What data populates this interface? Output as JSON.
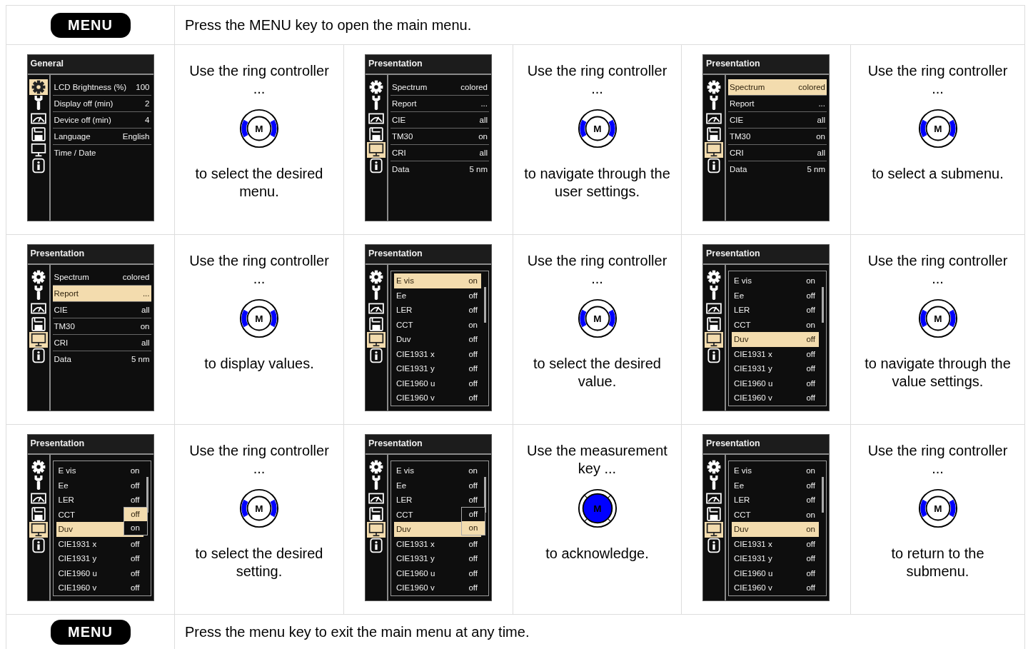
{
  "intro": {
    "key": "MENU",
    "text": "Press the MENU key to open the main menu."
  },
  "steps": [
    {
      "screen": {
        "kind": "menu",
        "title": "General",
        "sidebar": [
          {
            "kind": "gear",
            "selected": true
          },
          {
            "kind": "wrench",
            "selected": false
          },
          {
            "kind": "gauge",
            "selected": false
          },
          {
            "kind": "floppy",
            "selected": false
          },
          {
            "kind": "monitor",
            "selected": false
          },
          {
            "kind": "info",
            "selected": false
          }
        ],
        "items": [
          {
            "label": "LCD Brightness (%)",
            "value": "100",
            "selected": false
          },
          {
            "label": "Display off (min)",
            "value": "2",
            "selected": false
          },
          {
            "label": "Device off (min)",
            "value": "4",
            "selected": false
          },
          {
            "label": "Language",
            "value": "English",
            "selected": false
          },
          {
            "label": "Time / Date",
            "selected": false
          }
        ]
      },
      "before": "Use the ring controller ...",
      "knob": {
        "kind": "ring",
        "label": "M"
      },
      "after": "to select the desired menu."
    },
    {
      "screen": {
        "kind": "menu",
        "title": "Presentation",
        "sidebar": [
          {
            "kind": "gear",
            "selected": false
          },
          {
            "kind": "wrench",
            "selected": false
          },
          {
            "kind": "gauge",
            "selected": false
          },
          {
            "kind": "floppy",
            "selected": false
          },
          {
            "kind": "monitor",
            "selected": true
          },
          {
            "kind": "info",
            "selected": false
          }
        ],
        "items": [
          {
            "label": "Spectrum",
            "value": "colored",
            "selected": false
          },
          {
            "label": "Report",
            "value": "...",
            "selected": false
          },
          {
            "label": "CIE",
            "value": "all",
            "selected": false
          },
          {
            "label": "TM30",
            "value": "on",
            "selected": false
          },
          {
            "label": "CRI",
            "value": "all",
            "selected": false
          },
          {
            "label": "Data",
            "value": "5 nm",
            "selected": false
          }
        ]
      },
      "before": "Use the ring controller ...",
      "knob": {
        "kind": "ring",
        "label": "M"
      },
      "after": "to navigate through the user settings."
    },
    {
      "screen": {
        "kind": "menu",
        "title": "Presentation",
        "sidebar": [
          {
            "kind": "gear",
            "selected": false
          },
          {
            "kind": "wrench",
            "selected": false
          },
          {
            "kind": "gauge",
            "selected": false
          },
          {
            "kind": "floppy",
            "selected": false
          },
          {
            "kind": "monitor",
            "selected": true
          },
          {
            "kind": "info",
            "selected": false
          }
        ],
        "items": [
          {
            "label": "Spectrum",
            "value": "colored",
            "selected": true
          },
          {
            "label": "Report",
            "value": "...",
            "selected": false
          },
          {
            "label": "CIE",
            "value": "all",
            "selected": false
          },
          {
            "label": "TM30",
            "value": "on",
            "selected": false
          },
          {
            "label": "CRI",
            "value": "all",
            "selected": false
          },
          {
            "label": "Data",
            "value": "5 nm",
            "selected": false
          }
        ]
      },
      "before": "Use the ring controller ...",
      "knob": {
        "kind": "ring",
        "label": "M"
      },
      "after": "to select a submenu."
    },
    {
      "screen": {
        "kind": "menu",
        "title": "Presentation",
        "sidebar": [
          {
            "kind": "gear",
            "selected": false
          },
          {
            "kind": "wrench",
            "selected": false
          },
          {
            "kind": "gauge",
            "selected": false
          },
          {
            "kind": "floppy",
            "selected": false
          },
          {
            "kind": "monitor",
            "selected": true
          },
          {
            "kind": "info",
            "selected": false
          }
        ],
        "items": [
          {
            "label": "Spectrum",
            "value": "colored",
            "selected": false
          },
          {
            "label": "Report",
            "value": "...",
            "selected": true
          },
          {
            "label": "CIE",
            "value": "all",
            "selected": false
          },
          {
            "label": "TM30",
            "value": "on",
            "selected": false
          },
          {
            "label": "CRI",
            "value": "all",
            "selected": false
          },
          {
            "label": "Data",
            "value": "5 nm",
            "selected": false
          }
        ]
      },
      "before": "Use the ring controller ...",
      "knob": {
        "kind": "ring",
        "label": "M"
      },
      "after": "to display values."
    },
    {
      "screen": {
        "kind": "list",
        "title": "Presentation",
        "sidebar": [
          {
            "kind": "gear",
            "selected": false
          },
          {
            "kind": "wrench",
            "selected": false
          },
          {
            "kind": "gauge",
            "selected": false
          },
          {
            "kind": "floppy",
            "selected": false
          },
          {
            "kind": "monitor",
            "selected": true
          },
          {
            "kind": "info",
            "selected": false
          }
        ],
        "items": [
          {
            "label": "E vis",
            "value": "on",
            "selected": true
          },
          {
            "label": "Ee",
            "value": "off",
            "selected": false
          },
          {
            "label": "LER",
            "value": "off",
            "selected": false
          },
          {
            "label": "CCT",
            "value": "on",
            "selected": false
          },
          {
            "label": "Duv",
            "value": "off",
            "selected": false
          },
          {
            "label": "CIE1931 x",
            "value": "off",
            "selected": false
          },
          {
            "label": "CIE1931 y",
            "value": "off",
            "selected": false
          },
          {
            "label": "CIE1960 u",
            "value": "off",
            "selected": false
          },
          {
            "label": "CIE1960 v",
            "value": "off",
            "selected": false
          }
        ]
      },
      "before": "Use the ring controller ...",
      "knob": {
        "kind": "ring",
        "label": "M"
      },
      "after": "to select the desired value."
    },
    {
      "screen": {
        "kind": "list",
        "title": "Presentation",
        "sidebar": [
          {
            "kind": "gear",
            "selected": false
          },
          {
            "kind": "wrench",
            "selected": false
          },
          {
            "kind": "gauge",
            "selected": false
          },
          {
            "kind": "floppy",
            "selected": false
          },
          {
            "kind": "monitor",
            "selected": true
          },
          {
            "kind": "info",
            "selected": false
          }
        ],
        "items": [
          {
            "label": "E vis",
            "value": "on",
            "selected": false
          },
          {
            "label": "Ee",
            "value": "off",
            "selected": false
          },
          {
            "label": "LER",
            "value": "off",
            "selected": false
          },
          {
            "label": "CCT",
            "value": "on",
            "selected": false
          },
          {
            "label": "Duv",
            "value": "off",
            "selected": true
          },
          {
            "label": "CIE1931 x",
            "value": "off",
            "selected": false
          },
          {
            "label": "CIE1931 y",
            "value": "off",
            "selected": false
          },
          {
            "label": "CIE1960 u",
            "value": "off",
            "selected": false
          },
          {
            "label": "CIE1960 v",
            "value": "off",
            "selected": false
          }
        ]
      },
      "before": "Use the ring controller ...",
      "knob": {
        "kind": "ring",
        "label": "M"
      },
      "after": "to navigate through the value settings."
    },
    {
      "screen": {
        "kind": "list",
        "title": "Presentation",
        "sidebar": [
          {
            "kind": "gear",
            "selected": false
          },
          {
            "kind": "wrench",
            "selected": false
          },
          {
            "kind": "gauge",
            "selected": false
          },
          {
            "kind": "floppy",
            "selected": false
          },
          {
            "kind": "monitor",
            "selected": true
          },
          {
            "kind": "info",
            "selected": false
          }
        ],
        "items": [
          {
            "label": "E vis",
            "value": "on",
            "selected": false
          },
          {
            "label": "Ee",
            "value": "off",
            "selected": false
          },
          {
            "label": "LER",
            "value": "off",
            "selected": false
          },
          {
            "label": "CCT",
            "selected": false
          },
          {
            "label": "Duv",
            "selected": true
          },
          {
            "label": "CIE1931 x",
            "value": "off",
            "selected": false
          },
          {
            "label": "CIE1931 y",
            "value": "off",
            "selected": false
          },
          {
            "label": "CIE1960 u",
            "value": "off",
            "selected": false
          },
          {
            "label": "CIE1960 v",
            "value": "off",
            "selected": false
          }
        ],
        "popup": [
          {
            "label": "off",
            "selected": true
          },
          {
            "label": "on",
            "selected": false
          }
        ]
      },
      "before": "Use the ring controller ...",
      "knob": {
        "kind": "ring",
        "label": "M"
      },
      "after": "to select the desired setting."
    },
    {
      "screen": {
        "kind": "list",
        "title": "Presentation",
        "sidebar": [
          {
            "kind": "gear",
            "selected": false
          },
          {
            "kind": "wrench",
            "selected": false
          },
          {
            "kind": "gauge",
            "selected": false
          },
          {
            "kind": "floppy",
            "selected": false
          },
          {
            "kind": "monitor",
            "selected": true
          },
          {
            "kind": "info",
            "selected": false
          }
        ],
        "items": [
          {
            "label": "E vis",
            "value": "on",
            "selected": false
          },
          {
            "label": "Ee",
            "value": "off",
            "selected": false
          },
          {
            "label": "LER",
            "value": "off",
            "selected": false
          },
          {
            "label": "CCT",
            "selected": false
          },
          {
            "label": "Duv",
            "selected": true
          },
          {
            "label": "CIE1931 x",
            "value": "off",
            "selected": false
          },
          {
            "label": "CIE1931 y",
            "value": "off",
            "selected": false
          },
          {
            "label": "CIE1960 u",
            "value": "off",
            "selected": false
          },
          {
            "label": "CIE1960 v",
            "value": "off",
            "selected": false
          }
        ],
        "popup": [
          {
            "label": "off",
            "selected": false
          },
          {
            "label": "on",
            "selected": true
          }
        ]
      },
      "before": "Use the measurement key ...",
      "knob": {
        "kind": "key",
        "label": "M"
      },
      "after": "to acknowledge."
    },
    {
      "screen": {
        "kind": "list",
        "title": "Presentation",
        "sidebar": [
          {
            "kind": "gear",
            "selected": false
          },
          {
            "kind": "wrench",
            "selected": false
          },
          {
            "kind": "gauge",
            "selected": false
          },
          {
            "kind": "floppy",
            "selected": false
          },
          {
            "kind": "monitor",
            "selected": true
          },
          {
            "kind": "info",
            "selected": false
          }
        ],
        "items": [
          {
            "label": "E vis",
            "value": "on",
            "selected": false
          },
          {
            "label": "Ee",
            "value": "off",
            "selected": false
          },
          {
            "label": "LER",
            "value": "off",
            "selected": false
          },
          {
            "label": "CCT",
            "value": "on",
            "selected": false
          },
          {
            "label": "Duv",
            "value": "on",
            "selected": true
          },
          {
            "label": "CIE1931 x",
            "value": "off",
            "selected": false
          },
          {
            "label": "CIE1931 y",
            "value": "off",
            "selected": false
          },
          {
            "label": "CIE1960 u",
            "value": "off",
            "selected": false
          },
          {
            "label": "CIE1960 v",
            "value": "off",
            "selected": false
          }
        ]
      },
      "before": "Use the ring controller ...",
      "knob": {
        "kind": "ring",
        "label": "M"
      },
      "after": "to return to the submenu."
    }
  ],
  "outro": {
    "key": "MENU",
    "text": "Press the menu key to exit the main menu at any time."
  }
}
